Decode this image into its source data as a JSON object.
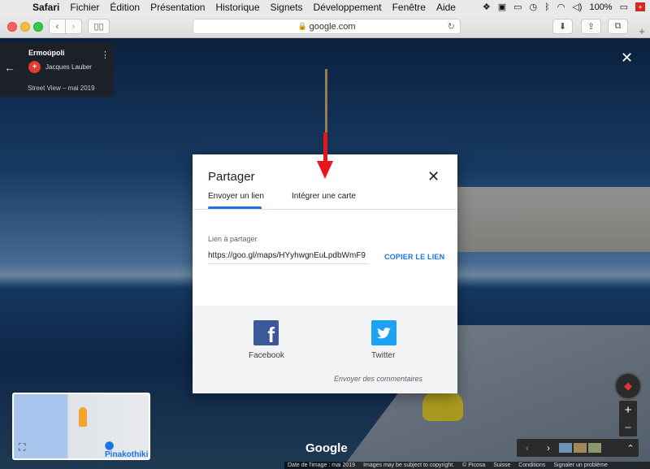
{
  "menubar": {
    "app": "Safari",
    "items": [
      "Fichier",
      "Édition",
      "Présentation",
      "Historique",
      "Signets",
      "Développement",
      "Fenêtre",
      "Aide"
    ],
    "battery": "100%"
  },
  "toolbar": {
    "url": "google.com"
  },
  "infocard": {
    "place": "Ermoúpoli",
    "author": "Jacques Lauber",
    "date": "Street View – mai 2019"
  },
  "dialog": {
    "title": "Partager",
    "tabs": [
      {
        "label": "Envoyer un lien",
        "active": true
      },
      {
        "label": "Intégrer une carte",
        "active": false
      }
    ],
    "field_label": "Lien à partager",
    "link": "https://goo.gl/maps/HYyhwgnEuLpdbWmF9",
    "copy_label": "COPIER LE LIEN",
    "social": [
      {
        "name": "Facebook",
        "icon": "facebook-icon"
      },
      {
        "name": "Twitter",
        "icon": "twitter-icon"
      }
    ],
    "feedback": "Envoyer des commentaires"
  },
  "minimap": {
    "poi": "Pinakothiki"
  },
  "map": {
    "logo": "Google"
  },
  "footer": {
    "items": [
      "Date de l'image : mai 2019",
      "Images may be subject to copyright.",
      "© Picosa",
      "Suisse",
      "Conditions",
      "Signaler un problème"
    ]
  },
  "colors": {
    "accent": "#1a73e8",
    "annotation_arrow": "#e8141b",
    "facebook": "#3b5998",
    "twitter": "#1da1f2"
  }
}
